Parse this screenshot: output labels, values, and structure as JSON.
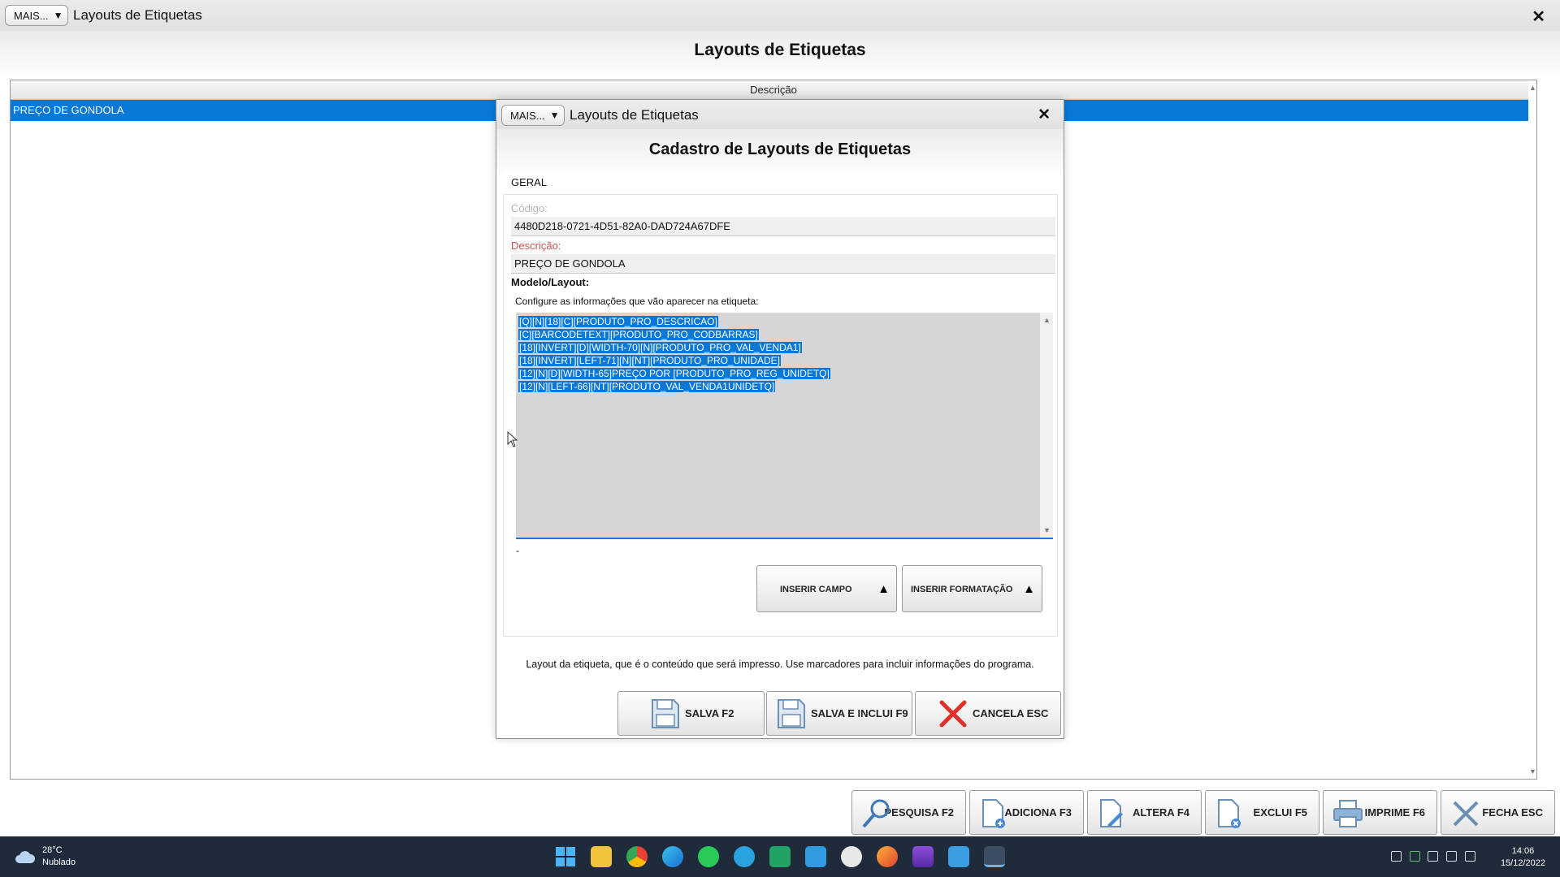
{
  "main_window": {
    "menu_label": "MAIS...",
    "title": "Layouts de Etiquetas",
    "close_glyph": "✕",
    "heading": "Layouts de Etiquetas"
  },
  "grid": {
    "column_header": "Descrição",
    "rows": [
      "PREÇO DE GONDOLA"
    ]
  },
  "toolbar": {
    "pesquisa": "PESQUISA F2",
    "adiciona": "ADICIONA F3",
    "altera": "ALTERA F4",
    "exclui": "EXCLUI F5",
    "imprime": "IMPRIME F6",
    "fecha": "FECHA ESC"
  },
  "dialog": {
    "menu_label": "MAIS...",
    "title": "Layouts de Etiquetas",
    "close_glyph": "✕",
    "heading": "Cadastro de Layouts de Etiquetas",
    "tab": "GERAL",
    "codigo_label": "Código:",
    "codigo_value": "4480D218-0721-4D51-82A0-DAD724A67DFE",
    "descricao_label": "Descrição:",
    "descricao_value": "PREÇO DE GONDOLA",
    "modelo_label": "Modelo/Layout:",
    "config_hint": "Configure as informações que vão aparecer na etiqueta:",
    "layout_lines": [
      "[Q][N][18][C][PRODUTO_PRO_DESCRICAO]",
      "[C][BARCODETEXT][PRODUTO_PRO_CODBARRAS]",
      "[18][INVERT][D][WIDTH-70][N][PRODUTO_PRO_VAL_VENDA1]",
      "[18][INVERT][LEFT-71][N][NT][PRODUTO_PRO_UNIDADE]",
      "[12][N][D][WIDTH-65]PREÇO POR [PRODUTO_PRO_REG_UNIDETQ]",
      "[12][N][LEFT-66][NT][PRODUTO_VAL_VENDA1UNIDETQ]"
    ],
    "under_textarea": "-",
    "inserir_campo": "INSERIR CAMPO",
    "inserir_formatacao": "INSERIR FORMATAÇÃO",
    "footnote": "Layout da etiqueta, que é o conteúdo que será impresso. Use marcadores para incluir informações do programa.",
    "salva": "SALVA F2",
    "salva_inclui": "SALVA E INCLUI F9",
    "cancela": "CANCELA ESC"
  },
  "taskbar": {
    "temperature": "28°C",
    "weather": "Nublado",
    "time": "14:06",
    "date": "15/12/2022"
  },
  "colors": {
    "selection": "#0a78d7",
    "taskbar": "#1f2a3a",
    "required_label": "#c7544f"
  }
}
